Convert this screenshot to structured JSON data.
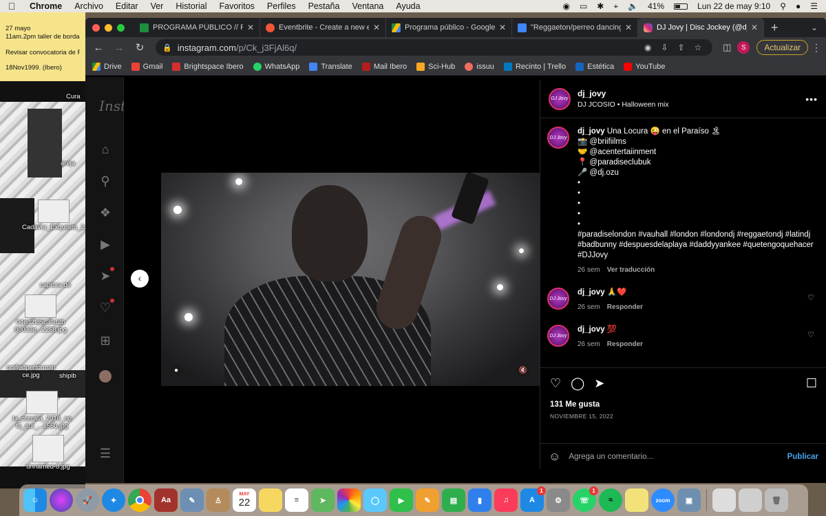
{
  "menubar": {
    "app": "Chrome",
    "menus": [
      "Archivo",
      "Editar",
      "Ver",
      "Historial",
      "Favoritos",
      "Perfiles",
      "Pestaña",
      "Ventana",
      "Ayuda"
    ],
    "battery": "41%",
    "datetime": "Lun 22 de may  9:10"
  },
  "notes": {
    "line1": "27 mayo",
    "line2": "11am.2pm taller de borda",
    "line3": "Revisar convocatoria de F",
    "line4": "18Nov1999. (Ibero)"
  },
  "desktop": {
    "icons": [
      "Cura",
      "areja",
      "Cadaver_Exquisito_2.jpg",
      "captura de",
      "04ed2f85c34d2b 80023e...2268.jpg",
      "onifiedperforman ce.jpg",
      "shipib",
      "la_corcala_2016_no te_sur_...x550.jpg",
      "unnamed-8.jpg"
    ]
  },
  "tabs": [
    {
      "title": "PROGRAMA PÚBLICO // PU",
      "color": "#1e8e3e"
    },
    {
      "title": "Eventbrite - Create a new e",
      "color": "#f05537"
    },
    {
      "title": "Programa público - Google",
      "color": "#fbbc04"
    },
    {
      "title": "\"Reggaeton/perreo dancing",
      "color": "#4285f4"
    },
    {
      "title": "DJ Jovy | Disc Jockey (@dj_",
      "color": "#c13584"
    }
  ],
  "address": {
    "host": "instagram.com",
    "path": "/p/Ck_j3FjAl6q/"
  },
  "toolbar": {
    "profile_initial": "S",
    "update_label": "Actualizar"
  },
  "bookmarks": [
    {
      "label": "Drive",
      "color": "#1a73e8"
    },
    {
      "label": "Gmail",
      "color": "#ea4335"
    },
    {
      "label": "Brightspace Ibero",
      "color": "#d32f2f"
    },
    {
      "label": "WhatsApp",
      "color": "#25d366"
    },
    {
      "label": "Translate",
      "color": "#4285f4"
    },
    {
      "label": "Mail Ibero",
      "color": "#b71c1c"
    },
    {
      "label": "Sci-Hub",
      "color": "#f9a825"
    },
    {
      "label": "issuu",
      "color": "#f36d5d"
    },
    {
      "label": "Recinto | Trello",
      "color": "#0079bf"
    },
    {
      "label": "Estética",
      "color": "#1565c0"
    },
    {
      "label": "YouTube",
      "color": "#ff0000"
    }
  ],
  "instagram": {
    "logo": "Insta",
    "post": {
      "username": "dj_jovy",
      "audio": "DJ JCOSIO • Halloween mix",
      "avatar_text": "DJ Jovy",
      "caption": {
        "username": "dj_jovy",
        "text": "Una Locura 😜 en el Paraíso 🏝",
        "lines": [
          "📸 @briifiilms",
          "🤝 @acentertaiinment",
          "📍 @paradiseclubuk",
          "🎤 @dj.ozu",
          "•",
          "•",
          "•",
          "•",
          "•"
        ],
        "hashtags": "#paradiselondon #vauhall #london #londondj #reggaetondj #latindj #badbunny #despuesdelaplaya #daddyyankee #quetengoquehacer #DJJovy",
        "age": "26 sem",
        "translate": "Ver traducción"
      },
      "comments": [
        {
          "username": "dj_jovy",
          "text": "🙏❤️",
          "age": "26 sem",
          "reply": "Responder"
        },
        {
          "username": "dj_jovy",
          "text": "💯",
          "age": "26 sem",
          "reply": "Responder"
        }
      ],
      "likes": "131 Me gusta",
      "date": "NOVIEMBRE 15, 2022",
      "comment_placeholder": "Agrega un comentario...",
      "publish": "Publicar"
    }
  },
  "dock": {
    "calendar_day": "22",
    "calendar_month": "MAY",
    "apps": [
      {
        "name": "finder",
        "color": "#2d8cf0"
      },
      {
        "name": "siri",
        "color": "#5e35b1"
      },
      {
        "name": "launchpad",
        "color": "#8e9aa6"
      },
      {
        "name": "safari",
        "color": "#1e88e5"
      },
      {
        "name": "chrome",
        "color": "#ffffff"
      },
      {
        "name": "dictionary",
        "color": "#a1332c"
      },
      {
        "name": "preview",
        "color": "#6d8fb3"
      },
      {
        "name": "contacts",
        "color": "#b38b5d"
      },
      {
        "name": "calendar",
        "color": "#ffffff"
      },
      {
        "name": "notes",
        "color": "#f6d860"
      },
      {
        "name": "reminders",
        "color": "#ffffff"
      },
      {
        "name": "maps",
        "color": "#5fb760"
      },
      {
        "name": "photos",
        "color": "#ffffff"
      },
      {
        "name": "messages",
        "color": "#3ccf4e"
      },
      {
        "name": "facetime",
        "color": "#2fbf4a"
      },
      {
        "name": "pages",
        "color": "#f0a030"
      },
      {
        "name": "numbers",
        "color": "#2fae4e"
      },
      {
        "name": "keynote",
        "color": "#2f80ed"
      },
      {
        "name": "music",
        "color": "#fa3c5a"
      },
      {
        "name": "app-store",
        "color": "#1e88e5"
      },
      {
        "name": "system-preferences",
        "color": "#8a8a8a"
      },
      {
        "name": "whatsapp",
        "color": "#25d366"
      },
      {
        "name": "spotify",
        "color": "#1db954"
      },
      {
        "name": "stickies",
        "color": "#f3e27a"
      },
      {
        "name": "zoom",
        "color": "#2d8cff"
      },
      {
        "name": "image-capture",
        "color": "#6e8fb0"
      },
      {
        "name": "document",
        "color": "#dddddd"
      },
      {
        "name": "screenshots",
        "color": "#cfcfcf"
      },
      {
        "name": "trash",
        "color": "#bdbdbd"
      }
    ]
  }
}
